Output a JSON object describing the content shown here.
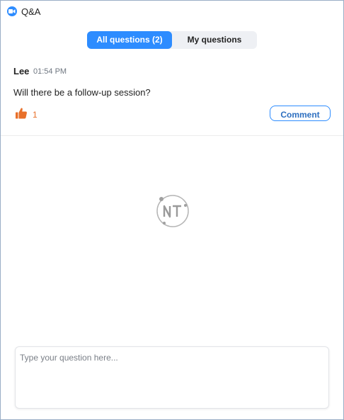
{
  "window": {
    "title": "Q&A",
    "app_icon": "zoom-camera-icon"
  },
  "tabs": [
    {
      "label": "All questions (2)",
      "active": true
    },
    {
      "label": "My questions",
      "active": false
    }
  ],
  "question": {
    "author": "Lee",
    "time": "01:54 PM",
    "text": "Will there be a follow-up session?",
    "likes": "1",
    "like_icon": "thumbs-up-icon",
    "comment_label": "Comment"
  },
  "compose": {
    "placeholder": "Type your question here..."
  },
  "colors": {
    "accent": "#2d8cff",
    "like": "#e8702a"
  }
}
